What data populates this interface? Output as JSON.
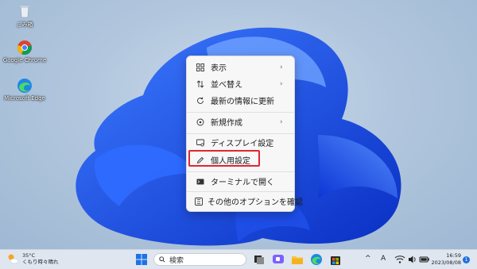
{
  "desktop": {
    "icons": [
      {
        "label": "ごみ箱",
        "icon": "recycle-bin-icon"
      },
      {
        "label": "Google Chrome",
        "icon": "chrome-icon"
      },
      {
        "label": "Microsoft Edge",
        "icon": "edge-icon"
      }
    ]
  },
  "context_menu": {
    "items": [
      {
        "label": "表示",
        "icon": "grid-view-icon",
        "submenu": true
      },
      {
        "label": "並べ替え",
        "icon": "sort-icon",
        "submenu": true
      },
      {
        "label": "最新の情報に更新",
        "icon": "refresh-icon",
        "submenu": false
      },
      {
        "label": "新規作成",
        "icon": "new-icon",
        "submenu": true
      },
      {
        "label": "ディスプレイ設定",
        "icon": "display-settings-icon",
        "submenu": false
      },
      {
        "label": "個人用設定",
        "icon": "pencil-icon",
        "submenu": false,
        "highlighted": true
      },
      {
        "label": "ターミナルで開く",
        "icon": "terminal-icon",
        "submenu": false
      },
      {
        "label": "その他のオプションを確認",
        "icon": "more-options-icon",
        "submenu": false
      }
    ],
    "arrow_glyph": "›",
    "highlight_color": "#e0262e"
  },
  "taskbar": {
    "weather": {
      "temp": "35°C",
      "condition": "くもり時々晴れ"
    },
    "search_label": "検索",
    "tray": {
      "chevron": "^",
      "ime": "A"
    },
    "clock": {
      "time": "16:59",
      "date": "2023/08/08"
    },
    "notification_count": "1"
  }
}
